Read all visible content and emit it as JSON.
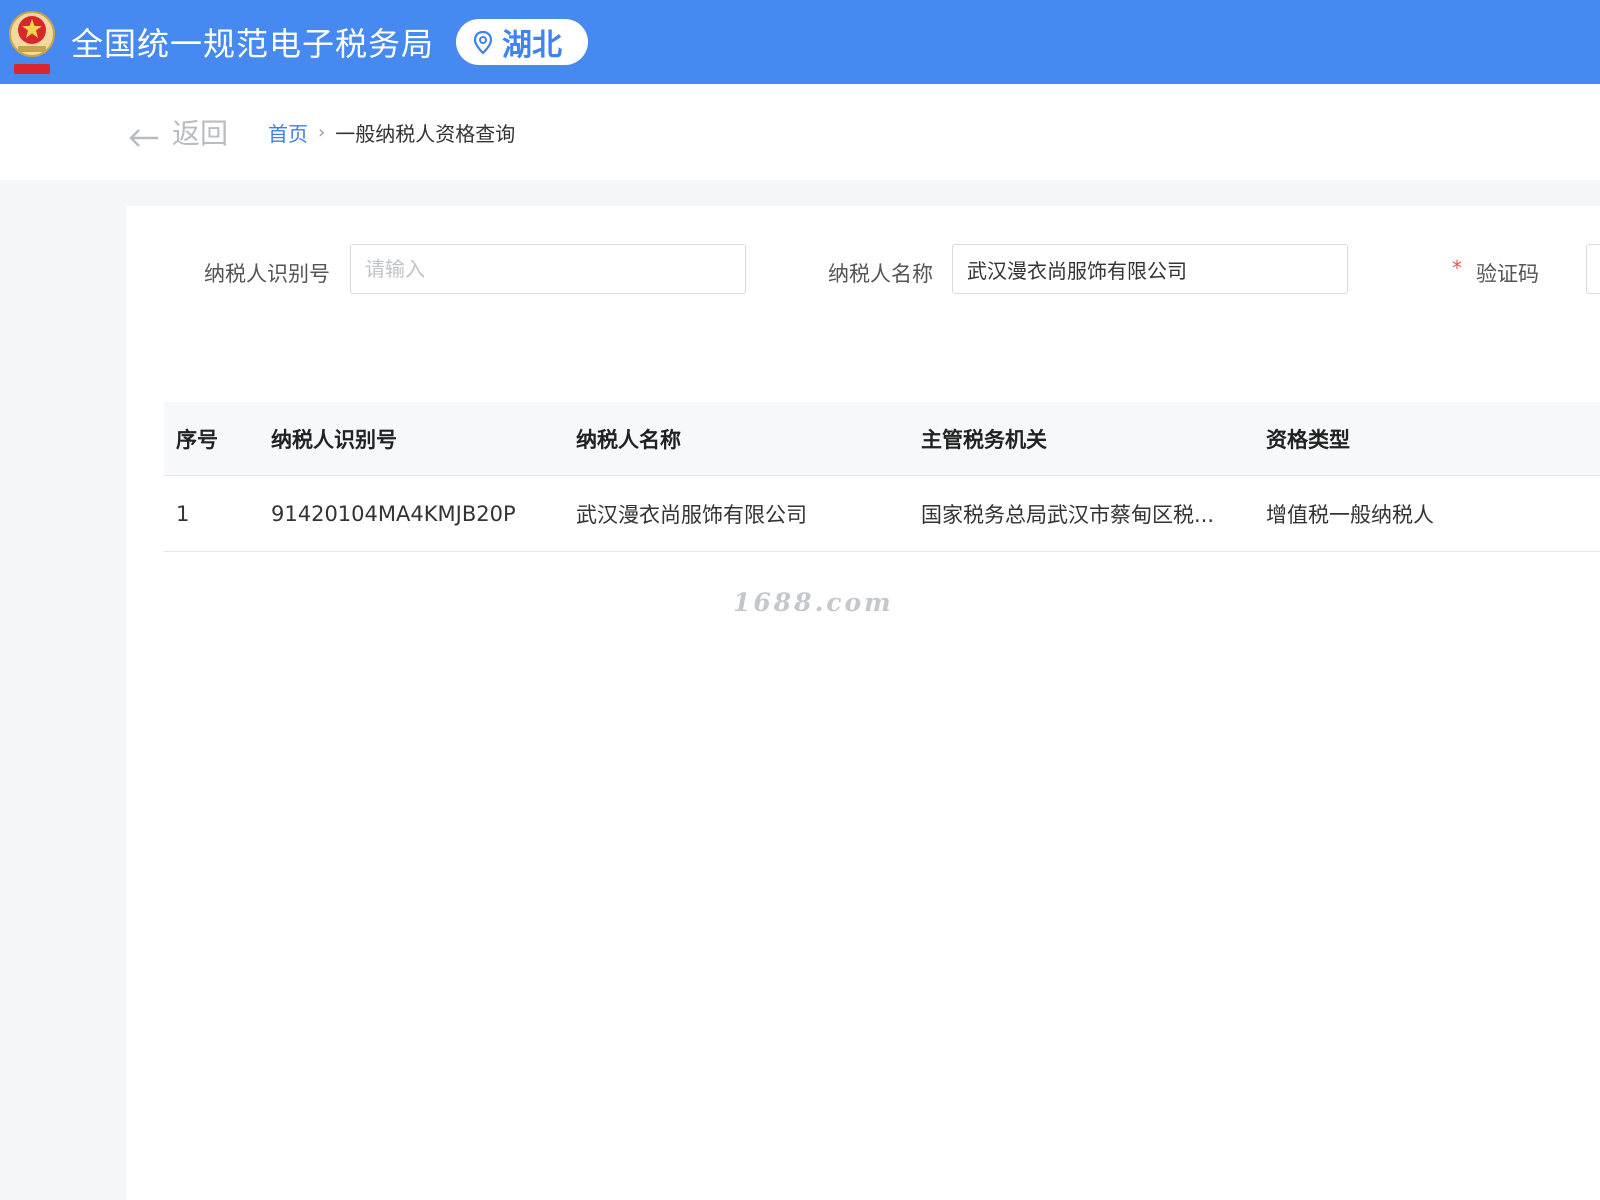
{
  "header": {
    "site_title": "全国统一规范电子税务局",
    "region": "湖北",
    "colors": {
      "bar": "#4689f0",
      "pill_text": "#3f83ee"
    }
  },
  "breadcrumb": {
    "back_label": "返回",
    "home": "首页",
    "separator": "›",
    "current": "一般纳税人资格查询"
  },
  "form": {
    "taxpayer_id_label": "纳税人识别号",
    "taxpayer_id_placeholder": "请输入",
    "taxpayer_id_value": "",
    "taxpayer_name_label": "纳税人名称",
    "taxpayer_name_value": "武汉漫衣尚服饰有限公司",
    "required_mark": "*",
    "captcha_label": "验证码"
  },
  "table": {
    "headers": [
      "序号",
      "纳税人识别号",
      "纳税人名称",
      "主管税务机关",
      "资格类型"
    ],
    "rows": [
      [
        "1",
        "91420104MA4KMJB20P",
        "武汉漫衣尚服饰有限公司",
        "国家税务总局武汉市蔡甸区税...",
        "增值税一般纳税人"
      ]
    ]
  },
  "watermark": "1688.com"
}
